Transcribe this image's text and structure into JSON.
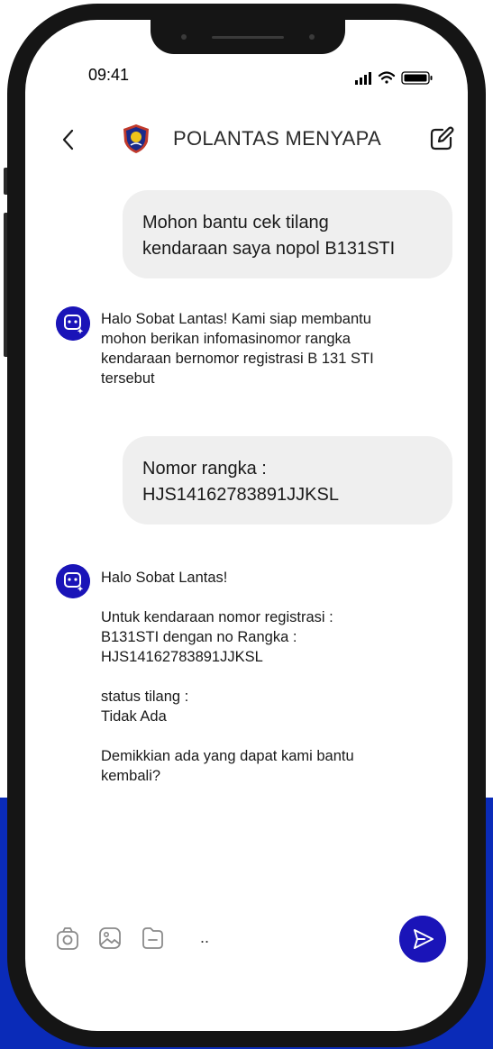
{
  "status_bar": {
    "time": "09:41"
  },
  "header": {
    "title": "POLANTAS MENYAPA",
    "back_icon": "chevron-left-icon",
    "edit_icon": "edit-icon"
  },
  "messages": [
    {
      "role": "user",
      "text": "Mohon bantu cek tilang\nkendaraan saya nopol B131STI"
    },
    {
      "role": "bot",
      "text": "Halo Sobat Lantas! Kami siap membantu\nmohon berikan infomasinomor rangka\nkendaraan bernomor registrasi B 131 STI\ntersebut"
    },
    {
      "role": "user",
      "text": "Nomor rangka :\nHJS14162783891JJKSL"
    },
    {
      "role": "bot",
      "text": "Halo Sobat Lantas!\n\nUntuk kendaraan nomor registrasi :\nB131STI dengan no Rangka :\nHJS14162783891JJKSL\n\nstatus tilang :\nTidak Ada\n\nDemikkian ada yang dapat kami bantu\nkembali?"
    }
  ],
  "composer": {
    "input_value": "..",
    "icons": [
      "camera-icon",
      "image-icon",
      "file-icon",
      "send-icon"
    ]
  },
  "colors": {
    "accent": "#1a14b8",
    "bubble": "#efefef",
    "background_band": "#0a2bb8"
  }
}
